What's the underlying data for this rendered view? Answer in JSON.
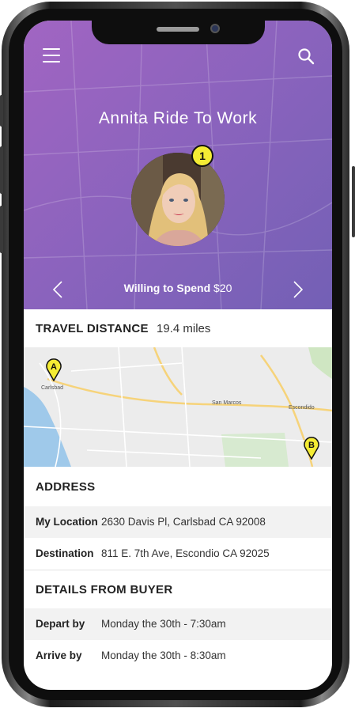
{
  "header": {
    "title": "Annita Ride To Work",
    "badge": "1",
    "spend_label": "Willing to Spend",
    "spend_value": "$20"
  },
  "travel": {
    "label": "TRAVEL DISTANCE",
    "value": "19.4 miles"
  },
  "map": {
    "pin_a": "A",
    "pin_b": "B",
    "places": {
      "carlsbad": "Carlsbad",
      "san_marcos": "San Marcos",
      "escondido": "Escondido"
    }
  },
  "address": {
    "title": "ADDRESS",
    "rows": [
      {
        "key": "My Location",
        "value": "2630 Davis Pl, Carlsbad CA 92008"
      },
      {
        "key": "Destination",
        "value": "811 E. 7th Ave, Escondio CA 92025"
      }
    ]
  },
  "details": {
    "title": "DETAILS FROM BUYER",
    "rows": [
      {
        "key": "Depart by",
        "value": "Monday the 30th - 7:30am"
      },
      {
        "key": "Arrive by",
        "value": "Monday the 30th - 8:30am"
      }
    ]
  },
  "colors": {
    "header_gradient_start": "#a165c2",
    "header_gradient_end": "#7360b5",
    "pin_yellow": "#f4ec34"
  }
}
